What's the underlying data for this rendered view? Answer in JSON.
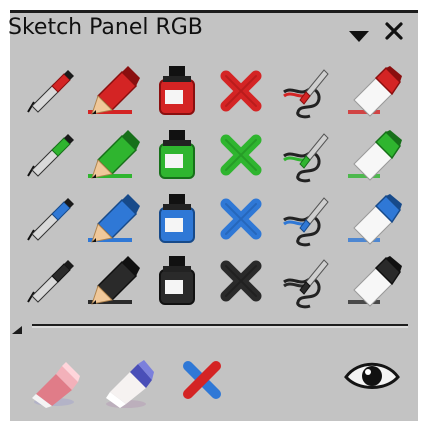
{
  "panel": {
    "title": "Sketch Panel RGB",
    "menu_icon": "triangle-down-icon",
    "close_icon": "close-icon"
  },
  "rows": [
    {
      "name": "red",
      "color": "#d42424",
      "dark": "#8a0f0f"
    },
    {
      "name": "green",
      "color": "#2fb52f",
      "dark": "#17701a"
    },
    {
      "name": "blue",
      "color": "#2f78d6",
      "dark": "#174a8a"
    },
    {
      "name": "black",
      "color": "#2a2a2a",
      "dark": "#111111"
    }
  ],
  "tools": [
    "pen-icon",
    "pencil-icon",
    "ink-bottle-icon",
    "delete-x-icon",
    "brush-stroke-icon",
    "eraser-icon"
  ],
  "bottom_tools": [
    "eraser-pink-icon",
    "eraser-blue-icon",
    "clear-x-icon",
    "eye-icon"
  ]
}
